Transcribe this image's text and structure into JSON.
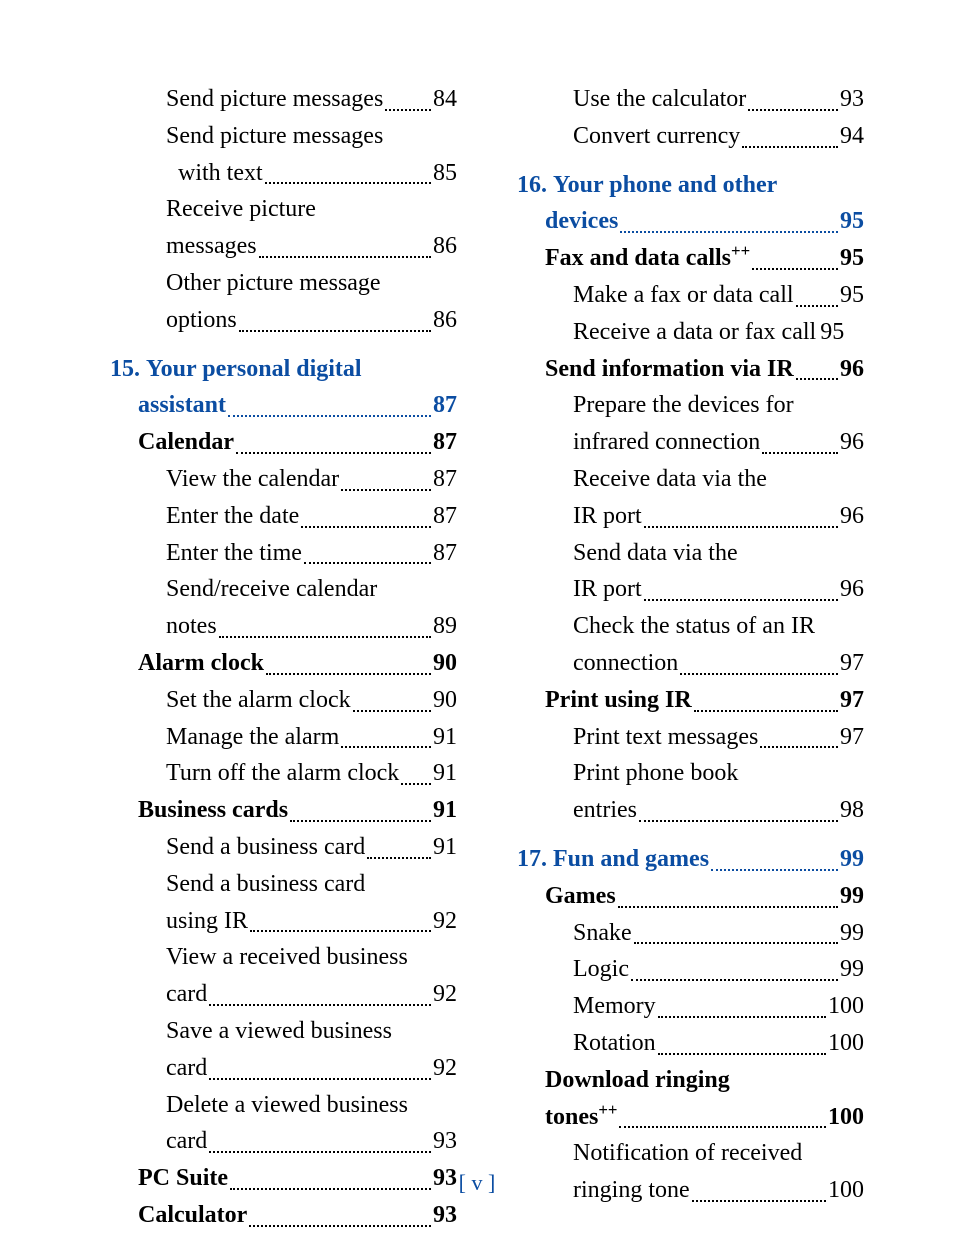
{
  "footer": "[ v ]",
  "left": [
    {
      "type": "group",
      "entries": [
        {
          "label": "Send picture messages",
          "page": "84",
          "indent": 2
        },
        {
          "label_lines": [
            "Send picture messages",
            " with text"
          ],
          "page": "85",
          "indent": 2,
          "cont_indent": "ind2c"
        },
        {
          "label_lines": [
            "Receive picture",
            "messages"
          ],
          "page": "86",
          "indent": 2
        },
        {
          "label_lines": [
            "Other picture message",
            "options"
          ],
          "page": "86",
          "indent": 2
        }
      ]
    },
    {
      "type": "group",
      "entries": [
        {
          "chapter": "15.",
          "label_lines": [
            "Your personal digital",
            "assistant"
          ],
          "page": "87",
          "indent": 0,
          "bold": true,
          "blue": true
        },
        {
          "label": "Calendar",
          "page": "87",
          "indent": 1,
          "bold": true
        },
        {
          "label": "View the calendar",
          "page": "87",
          "indent": 2
        },
        {
          "label": "Enter the date",
          "page": "87",
          "indent": 2
        },
        {
          "label": "Enter the time",
          "page": "87",
          "indent": 2
        },
        {
          "label_lines": [
            "Send/receive calendar",
            "notes"
          ],
          "page": "89",
          "indent": 2
        },
        {
          "label": "Alarm clock",
          "page": "90",
          "indent": 1,
          "bold": true
        },
        {
          "label": "Set the alarm clock",
          "page": "90",
          "indent": 2
        },
        {
          "label": "Manage the alarm",
          "page": "91",
          "indent": 2
        },
        {
          "label": "Turn off the alarm clock",
          "page": "91",
          "indent": 2
        },
        {
          "label": "Business cards",
          "page": "91",
          "indent": 1,
          "bold": true
        },
        {
          "label": "Send a business card",
          "page": "91",
          "indent": 2
        },
        {
          "label_lines": [
            "Send a business card",
            "using IR"
          ],
          "page": "92",
          "indent": 2
        },
        {
          "label_lines": [
            "View a received business",
            "card"
          ],
          "page": "92",
          "indent": 2
        },
        {
          "label_lines": [
            "Save a viewed business",
            "card"
          ],
          "page": "92",
          "indent": 2
        },
        {
          "label_lines": [
            "Delete a viewed business",
            "card"
          ],
          "page": "93",
          "indent": 2
        },
        {
          "label": "PC Suite",
          "page": "93",
          "indent": 1,
          "bold": true
        },
        {
          "label": "Calculator",
          "page": "93",
          "indent": 1,
          "bold": true
        }
      ]
    }
  ],
  "right": [
    {
      "type": "group",
      "entries": [
        {
          "label": "Use the calculator",
          "page": "93",
          "indent": 2
        },
        {
          "label": "Convert currency",
          "page": "94",
          "indent": 2
        }
      ]
    },
    {
      "type": "group",
      "entries": [
        {
          "chapter": "16.",
          "label_lines": [
            "Your phone and other",
            "devices"
          ],
          "page": "95",
          "indent": 0,
          "bold": true,
          "blue": true
        },
        {
          "label_html": "Fax and data calls<sup>++</sup>",
          "page": "95",
          "indent": 1,
          "bold": true
        },
        {
          "label": "Make a fax or data call",
          "page": "95",
          "indent": 2
        },
        {
          "label": "Receive a data or fax call",
          "page": "95",
          "indent": 2,
          "tight": true
        },
        {
          "label": "Send information via IR",
          "page": "96",
          "indent": 1,
          "bold": true
        },
        {
          "label_lines": [
            "Prepare the devices for",
            "infrared connection"
          ],
          "page": "96",
          "indent": 2
        },
        {
          "label_lines": [
            "Receive data via the",
            "IR port"
          ],
          "page": "96",
          "indent": 2
        },
        {
          "label_lines": [
            "Send data via the",
            "IR port"
          ],
          "page": "96",
          "indent": 2
        },
        {
          "label_lines": [
            "Check the status of an IR",
            "connection"
          ],
          "page": "97",
          "indent": 2
        },
        {
          "label": "Print using IR",
          "page": "97",
          "indent": 1,
          "bold": true
        },
        {
          "label": "Print text messages",
          "page": "97",
          "indent": 2
        },
        {
          "label_lines": [
            "Print phone book",
            "entries"
          ],
          "page": "98",
          "indent": 2
        }
      ]
    },
    {
      "type": "group",
      "entries": [
        {
          "chapter": "17.",
          "label": "Fun and games",
          "page": "99",
          "indent": 0,
          "bold": true,
          "blue": true
        },
        {
          "label": "Games",
          "page": "99",
          "indent": 1,
          "bold": true
        },
        {
          "label": "Snake",
          "page": "99",
          "indent": 2
        },
        {
          "label": "Logic",
          "page": "99",
          "indent": 2
        },
        {
          "label": "Memory",
          "page": "100",
          "indent": 2
        },
        {
          "label": "Rotation",
          "page": "100",
          "indent": 2
        },
        {
          "label_lines_html": [
            "Download ringing",
            "tones<sup>++</sup>"
          ],
          "page": "100",
          "indent": 1,
          "bold": true
        },
        {
          "label_lines": [
            "Notification of received",
            "ringing tone"
          ],
          "page": "100",
          "indent": 2
        }
      ]
    }
  ]
}
